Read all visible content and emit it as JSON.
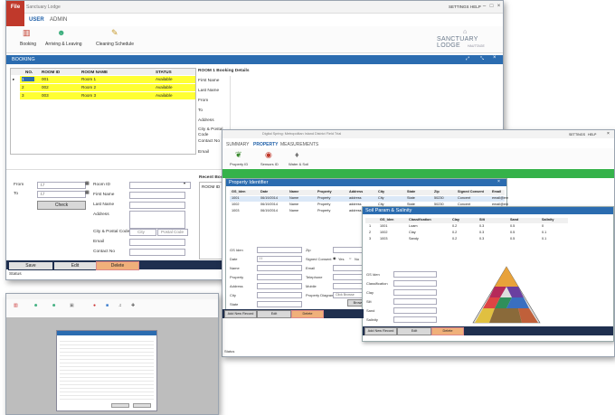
{
  "booking_win": {
    "title": "Sanctuary Lodge",
    "top_links": [
      "SETTINGS",
      "HELP"
    ],
    "file_label": "File",
    "tabs": [
      "USER",
      "ADMIN"
    ],
    "ribbon": [
      "Booking",
      "Arriving & Leaving",
      "Cleaning Schedule"
    ],
    "logo_main": "SANCTUARY LODGE",
    "logo_sub": "HAUTTAGE",
    "section": "BOOKING",
    "grid_headers": [
      "NO.",
      "ROOM ID",
      "ROOM NAME",
      "STATUS"
    ],
    "rows": [
      {
        "no": "1",
        "id": "001",
        "name": "Room 1",
        "status": "Available"
      },
      {
        "no": "2",
        "id": "002",
        "name": "Room 2",
        "status": "Available"
      },
      {
        "no": "3",
        "id": "003",
        "name": "Room 3",
        "status": "Available"
      }
    ],
    "details_title": "ROOM 1 Booking Details",
    "details_labels": [
      "First Name",
      "Last Name",
      "From",
      "To",
      "Address",
      "City & Postal Code",
      "Contact No",
      "Email"
    ],
    "from_label": "From",
    "to_label": "To",
    "from_value": "/ /",
    "to_value": "/ /",
    "room_id_label": "Room ID",
    "check_btn": "Check",
    "form_labels": [
      "First Name",
      "Last Name",
      "Address",
      "City & Postal Code",
      "Email",
      "Contact No"
    ],
    "city_ph": "City",
    "postal_ph": "Postal Code",
    "recent_title": "Recent Booki",
    "recent_col": "ROOM ID",
    "buttons": [
      "Save",
      "Edit",
      "Delete"
    ],
    "status": "Status"
  },
  "soil_win": {
    "title": "Digital Spring: Metropolitan Inland District Field Trial",
    "top_links": [
      "SETTINGS",
      "HELP"
    ],
    "tabs": [
      "SUMMARY",
      "PROPERTY",
      "MEASUREMENTS"
    ],
    "ribbon": [
      "Property ID",
      "Sensors ID",
      "Water & Soil"
    ],
    "prop_title": "Property Identifier",
    "prop_headers": [
      "GS_Iden",
      "Date",
      "Name",
      "Property",
      "Address",
      "City",
      "State",
      "Zip",
      "Signed Consent",
      "Email"
    ],
    "prop_rows": [
      [
        "1001",
        "06/19/2014",
        "Name",
        "Property",
        "address",
        "City",
        "State",
        "50230",
        "Concent",
        "email@em"
      ],
      [
        "1002",
        "06/19/2014",
        "Name",
        "Property",
        "address",
        "City",
        "State",
        "50230",
        "Concent",
        "email@em"
      ],
      [
        "1003",
        "06/19/2014",
        "Name",
        "Property",
        "address",
        "City",
        "State",
        "50230",
        "Concent",
        "email@em"
      ]
    ],
    "form_labels_left": [
      "GS Iden",
      "Date",
      "Name",
      "Property",
      "Address",
      "City",
      "State"
    ],
    "date_value": "/ /",
    "form_labels_mid": [
      "Zip",
      "Signed Consent",
      "Email",
      "Telephone",
      "Mobile",
      "Property Diagram"
    ],
    "yes_label": "Yes",
    "no_label": "No",
    "click_browse": "Click Browse",
    "browse_btn": "Browse",
    "buttons": [
      "Add New Record",
      "Edit",
      "Delete"
    ],
    "status": "Status"
  },
  "soil_param": {
    "title": "Soil Param & Salinity",
    "headers": [
      "GS_Iden",
      "Classification",
      "Clay",
      "Silt",
      "Sand",
      "Salinity"
    ],
    "rows": [
      [
        "1",
        "1001",
        "Loam",
        "0.2",
        "0.3",
        "0.5",
        "0"
      ],
      [
        "2",
        "1002",
        "Clay",
        "0.2",
        "0.3",
        "0.5",
        "0.1"
      ],
      [
        "3",
        "1003",
        "Sandy",
        "0.2",
        "0.3",
        "0.5",
        "0.1"
      ]
    ],
    "form_labels": [
      "GS Iden",
      "Classification",
      "Clay",
      "Silt",
      "Sand",
      "Salinity"
    ],
    "buttons": [
      "Add New Record",
      "Edit",
      "Delete"
    ]
  },
  "colors": {
    "blue": "#2b6cb0",
    "navy": "#1f2f4f",
    "yellow": "#ffff33",
    "orange": "#f0b07a",
    "green": "#35b24a",
    "red": "#c0392b"
  }
}
